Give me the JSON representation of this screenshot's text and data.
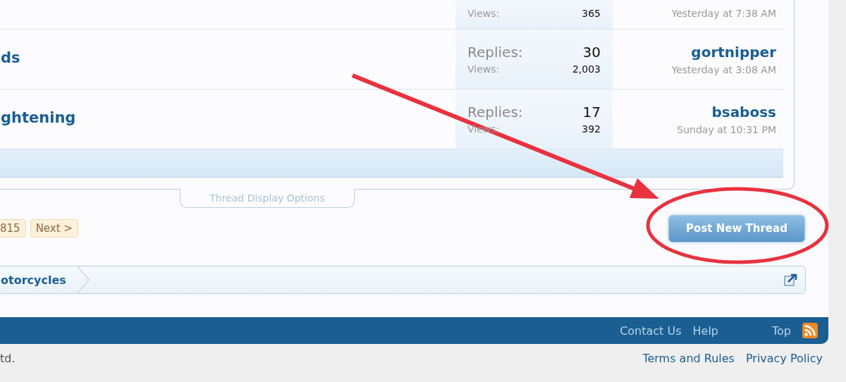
{
  "threads": [
    {
      "views_label": "Views:",
      "views": "365",
      "last_time": "Yesterday at 7:38 AM"
    },
    {
      "title": "ds",
      "replies_label": "Replies:",
      "replies": "30",
      "views_label": "Views:",
      "views": "2,003",
      "last_poster": "gortnipper",
      "last_time": "Yesterday at 3:08 AM"
    },
    {
      "title": "ghtening",
      "replies_label": "Replies:",
      "replies": "17",
      "views_label": "Views:",
      "views": "392",
      "last_poster": "bsaboss",
      "last_time": "Sunday at 10:31 PM"
    }
  ],
  "thread_display_options": "Thread Display Options",
  "pagination": [
    "815",
    "Next >"
  ],
  "post_button": "Post New Thread",
  "breadcrumb": "otorcycles",
  "footer_links": [
    "Contact Us",
    "Help",
    "Top"
  ],
  "copyright": "td.",
  "legal_links": [
    "Terms and Rules",
    "Privacy Policy"
  ]
}
